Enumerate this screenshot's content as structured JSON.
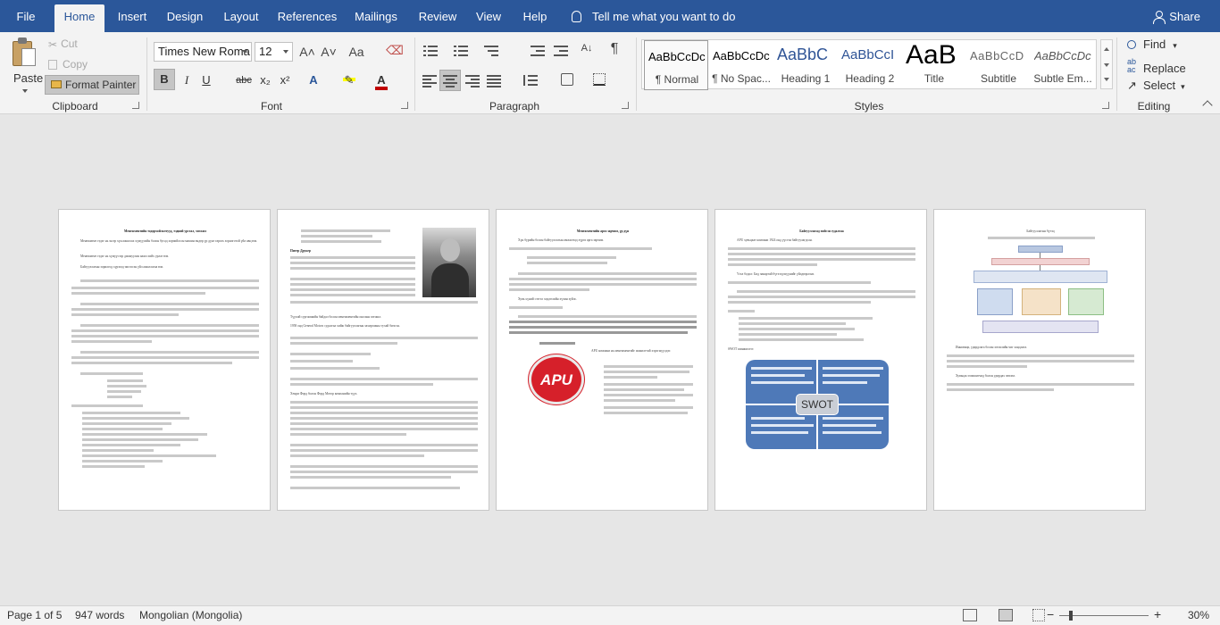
{
  "tabs": [
    {
      "label": "File"
    },
    {
      "label": "Home"
    },
    {
      "label": "Insert"
    },
    {
      "label": "Design"
    },
    {
      "label": "Layout"
    },
    {
      "label": "References"
    },
    {
      "label": "Mailings"
    },
    {
      "label": "Review"
    },
    {
      "label": "View"
    },
    {
      "label": "Help"
    }
  ],
  "tell_me": "Tell me what you want to do",
  "share": "Share",
  "clipboard": {
    "paste": "Paste",
    "cut": "Cut",
    "copy": "Copy",
    "format_painter": "Format Painter",
    "label": "Clipboard"
  },
  "font": {
    "name": "Times New Roma",
    "size": "12",
    "label": "Font",
    "bold": "B",
    "italic": "I",
    "underline": "U",
    "strike": "abc",
    "sub": "x₂",
    "sup": "x²",
    "grow": "A˄",
    "shrink": "A˅",
    "case": "Aa",
    "highlight_color": "#ffff00",
    "font_color": "#c00000"
  },
  "paragraph": {
    "label": "Paragraph",
    "pilcrow": "¶"
  },
  "styles": {
    "label": "Styles",
    "items": [
      {
        "preview": "AaBbCcDc",
        "name": "¶ Normal"
      },
      {
        "preview": "AaBbCcDc",
        "name": "¶ No Spac..."
      },
      {
        "preview": "AaBbC",
        "name": "Heading 1"
      },
      {
        "preview": "AaBbCcI",
        "name": "Heading 2"
      },
      {
        "preview": "AaB",
        "name": "Title"
      },
      {
        "preview": "AaBbCcD",
        "name": "Subtitle"
      },
      {
        "preview": "AaBbCcDc",
        "name": "Subtle Em..."
      }
    ]
  },
  "editing": {
    "label": "Editing",
    "find": "Find",
    "replace": "Replace",
    "select": "Select"
  },
  "pages": [
    {
      "title": "Менежментийн тодорхойлолтууд, тэдний урсгал, хөгжил",
      "lines": [
        "Менежмент гэдэг нь эн өр хүн ажиллах хүмүүсийн болон бусад хорчийлсон машин өндөр үр дүнг гаргах зорилготой үйл явц юм.",
        "Менежмент гэдэг нь хүмүүсээр дамжуулан ажил хийх урлаг юм.",
        "Байгууллагын зорилгод хүрэхэд чиглэсэн үйл ажиллагаа юм."
      ]
    },
    {
      "title": "Питер Друкер",
      "lines": [
        "Түүхий сургамжийн байдал болон менежментийн онолын хөгжил.",
        "1958 онд General Motors судалгаа хийж байгууллагын захиргааны тухай бичсэн.",
        "Хенри Форд болон Форд Мотор компанийн түүх."
      ]
    },
    {
      "title": "Менежментийн арга зарчим, үр дүн",
      "lines": [
        "Хүн бүрийн болон байгууллагын амжилтад хүрэх арга зарчим.",
        "Хувь хүний сэтгэл хөдлөлийн хүчин зүйлс.",
        "APU компани нь менежментийг амжилттай хэрэгжүүлдэг."
      ],
      "logo": "APU"
    },
    {
      "title": "Байгууллагад хийсэн судалгаа",
      "lines": [
        "APU хувьцаат компани 1924 онд үүсгэн байгуулагдсан.",
        "Үзэл бодол: Бид чанартай бүтээгдэхүүнийг үйлдвэрлэнэ.",
        "SWOT шинжилгээ"
      ],
      "swot": "SWOT"
    },
    {
      "title": "Байгууллагын бүтэц",
      "lines": [
        "Инноваци, удирдлага болон хөгжлийн чиг хандлага.",
        "Хувьцаа эзэмшигчид болон удирдах зөвлөл."
      ]
    }
  ],
  "status": {
    "page": "Page 1 of 5",
    "words": "947 words",
    "language": "Mongolian (Mongolia)",
    "zoom": "30%",
    "zoom_fraction": 0.3
  }
}
